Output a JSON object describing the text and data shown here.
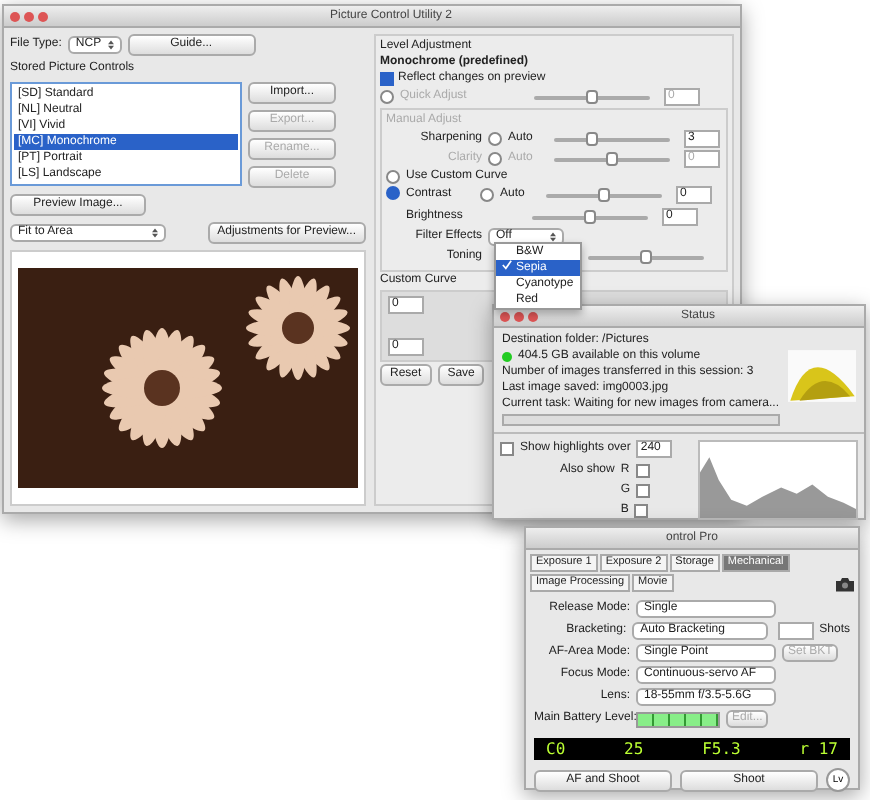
{
  "window": {
    "title": "Picture Control Utility 2"
  },
  "file_type": {
    "label": "File Type:",
    "value": "NCP"
  },
  "guide_button": "Guide...",
  "stored_label": "Stored Picture Controls",
  "controls": [
    {
      "label": "[SD] Standard",
      "selected": false
    },
    {
      "label": "[NL] Neutral",
      "selected": false
    },
    {
      "label": "[VI] Vivid",
      "selected": false
    },
    {
      "label": "[MC] Monochrome",
      "selected": true
    },
    {
      "label": "[PT] Portrait",
      "selected": false
    },
    {
      "label": "[LS] Landscape",
      "selected": false
    }
  ],
  "side_buttons": [
    {
      "label": "Import...",
      "disabled": false
    },
    {
      "label": "Export...",
      "disabled": true
    },
    {
      "label": "Rename...",
      "disabled": true
    },
    {
      "label": "Delete",
      "disabled": true
    }
  ],
  "preview_button": "Preview Image...",
  "fit_select": "Fit to Area",
  "adjustments_button": "Adjustments for Preview...",
  "level_adjustment": {
    "title": "Level Adjustment",
    "preset": "Monochrome (predefined)",
    "reflect": {
      "label": "Reflect changes on preview",
      "checked": true
    },
    "quick_adjust": {
      "label": "Quick Adjust",
      "disabled": true,
      "level": 0.5,
      "value": "0"
    },
    "manual_adjust": {
      "label": "Manual Adjust",
      "disabled": true
    },
    "sliders": [
      {
        "label": "Sharpening",
        "auto": "Auto",
        "auto_checked": false,
        "disabled": false,
        "level": 0.33,
        "value": "3"
      },
      {
        "label": "Clarity",
        "auto": "Auto",
        "auto_checked": false,
        "disabled": true,
        "level": 0.5,
        "value": "0"
      }
    ],
    "custom_curve_radio": {
      "label": "Use Custom Curve",
      "selected": false
    },
    "curve_sliders": [
      {
        "label": "Contrast",
        "auto": "Auto",
        "auto_checked": false,
        "level": 0.5,
        "value": "0"
      },
      {
        "label": "Brightness",
        "level": 0.5,
        "value": "0"
      }
    ],
    "levels_radio_selected": true,
    "filter_effects": {
      "label": "Filter Effects",
      "value": "Off"
    },
    "toning": {
      "label": "Toning",
      "level": 0.5,
      "options": [
        {
          "label": "B&W",
          "selected": false
        },
        {
          "label": "Sepia",
          "selected": true
        },
        {
          "label": "Cyanotype",
          "selected": false
        },
        {
          "label": "Red",
          "selected": false
        }
      ]
    },
    "custom_curve_label": "Custom Curve",
    "fields": [
      "0",
      "0"
    ],
    "reset_button": "Reset",
    "save_button": "Save"
  },
  "status": {
    "title": "Status",
    "lines": [
      "Destination folder: /Pictures",
      "404.5 GB available on this volume",
      "Number of images transferred in this session: 3",
      "Last image saved: img0003.jpg",
      "Current task: Waiting for new images from camera..."
    ],
    "progress": {
      "level": 0
    },
    "show_highlights": {
      "label": "Show highlights over",
      "checked": false,
      "value": "240"
    },
    "also_show": "Also show",
    "channels": [
      {
        "label": "R",
        "checked": false
      },
      {
        "label": "G",
        "checked": false
      },
      {
        "label": "B",
        "checked": false
      }
    ]
  },
  "camera": {
    "title": "ontrol Pro",
    "tabs": [
      {
        "label": "Exposure 1",
        "selected": false
      },
      {
        "label": "Exposure 2",
        "selected": false
      },
      {
        "label": "Storage",
        "selected": false
      },
      {
        "label": "Mechanical",
        "selected": true
      },
      {
        "label": "Image Processing",
        "selected": false
      },
      {
        "label": "Movie",
        "selected": false
      }
    ],
    "rows": [
      {
        "label": "Release Mode:",
        "value": "Single"
      },
      {
        "label": "Bracketing:",
        "value": "Auto Bracketing"
      },
      {
        "label": "AF-Area Mode:",
        "value": "Single Point"
      },
      {
        "label": "Focus Mode:",
        "value": "Continuous-servo AF"
      },
      {
        "label": "Lens:",
        "value": "18-55mm f/3.5-5.6G"
      }
    ],
    "shots": "Shots",
    "set_bkt": "Set BKT",
    "edit": "Edit...",
    "battery": {
      "label": "Main Battery Level:",
      "level": 1
    },
    "display": [
      "C0",
      "25",
      "F5.3",
      "r 17"
    ],
    "af_shoot": "AF and Shoot",
    "shoot": "Shoot",
    "lv": "Lv"
  }
}
